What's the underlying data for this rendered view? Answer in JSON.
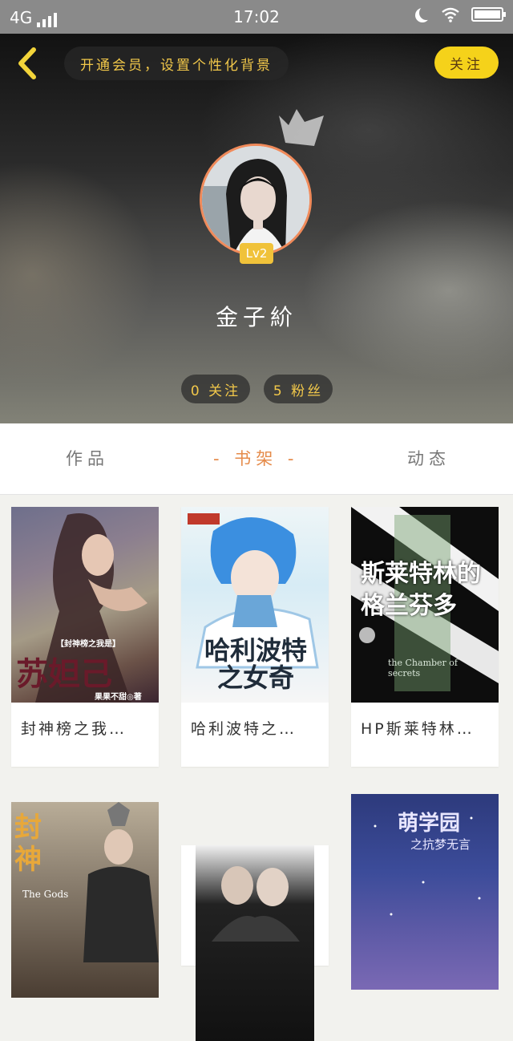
{
  "status_bar": {
    "network": "4G",
    "time": "17:02"
  },
  "header": {
    "vip_banner": "开通会员，设置个性化背景",
    "follow_button": "关注",
    "level": "Lv2",
    "username": "金子紒",
    "following": "0 关注",
    "fans": "5 粉丝"
  },
  "tabs": [
    {
      "label": "作品"
    },
    {
      "label": "- 书架 -"
    },
    {
      "label": "动态"
    }
  ],
  "active_tab": "书架",
  "books": [
    {
      "title": "封神榜之我…",
      "cover_text": "苏妲己",
      "cover_small": "【封神榜之我是】",
      "cover_author": "果果不甜◎著"
    },
    {
      "title": "哈利波特之…",
      "cover_text": "哈利波特之女奇"
    },
    {
      "title": "HP斯莱特林…",
      "cover_text": "斯莱特林的格兰芬多",
      "cover_small": "the Chamber of secrets"
    },
    {
      "title": "",
      "cover_text": "封神",
      "cover_small": "The Gods"
    },
    {
      "title": "",
      "cover_text": ""
    },
    {
      "title": "",
      "cover_text": "萌学园",
      "cover_small": "之抗梦无言"
    }
  ],
  "colors": {
    "accent": "#e58b4a",
    "gold": "#f2c84a",
    "follow_bg": "#f5d21a",
    "avatar_ring": "#f08a5a"
  }
}
